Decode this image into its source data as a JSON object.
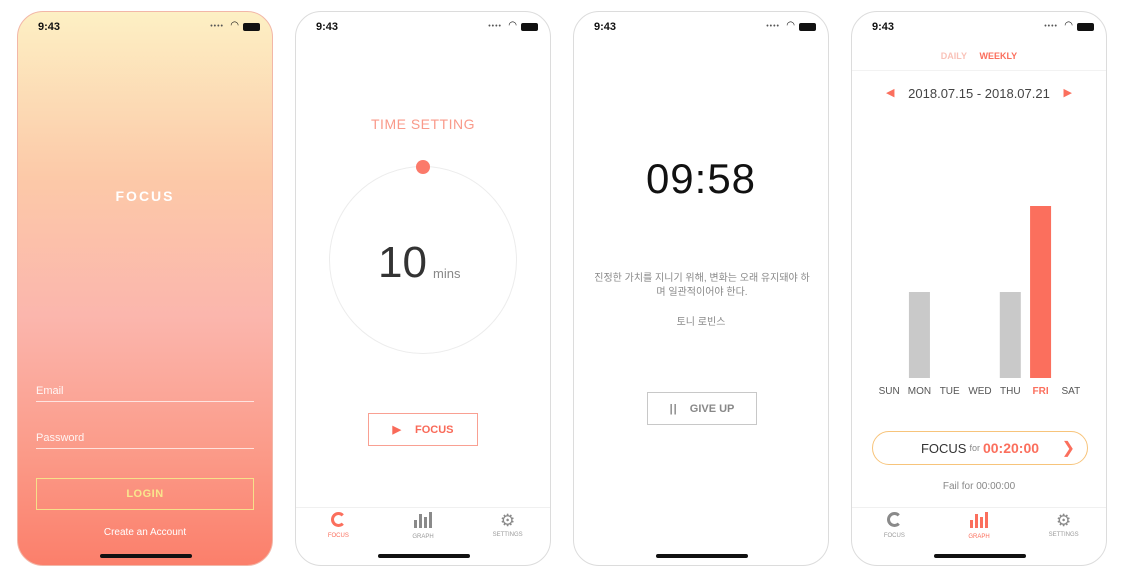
{
  "status": {
    "time": "9:43"
  },
  "login": {
    "brand": "FOCUS",
    "email_placeholder": "Email",
    "password_placeholder": "Password",
    "login_label": "LOGIN",
    "create_account": "Create an Account"
  },
  "timer_setting": {
    "title": "TIME SETTING",
    "value": "10",
    "unit": "mins",
    "focus_label": "FOCUS"
  },
  "countdown": {
    "time": "09:58",
    "quote": "진정한 가치를 지니기 위해, 변화는 오래 유지돼야 하며 일관적이어야 한다.",
    "author": "토니 로빈스",
    "give_up_label": "GIVE UP"
  },
  "stats": {
    "toggle_daily": "DAILY",
    "toggle_weekly": "WEEKLY",
    "date_range": "2018.07.15 - 2018.07.21",
    "focus_label": "FOCUS",
    "focus_for": "for",
    "focus_duration": "00:20:00",
    "fail_text": "Fail for 00:00:00"
  },
  "tabs": [
    {
      "label": "FOCUS",
      "icon": "focus-ring-icon"
    },
    {
      "label": "GRAPH",
      "icon": "bar-graph-icon"
    },
    {
      "label": "SETTINGS",
      "icon": "gear-icon"
    }
  ],
  "colors": {
    "accent": "#fb6f5d",
    "bar_inactive": "#c9c9c9",
    "highlight_border": "#f7c47b"
  },
  "chart_data": {
    "type": "bar",
    "categories": [
      "SUN",
      "MON",
      "TUE",
      "WED",
      "THU",
      "FRI",
      "SAT"
    ],
    "values": [
      0,
      10,
      0,
      0,
      10,
      20,
      0
    ],
    "highlight": "FRI",
    "ylim": [
      0,
      20
    ],
    "xlabel": "",
    "ylabel": "",
    "grid": false
  }
}
